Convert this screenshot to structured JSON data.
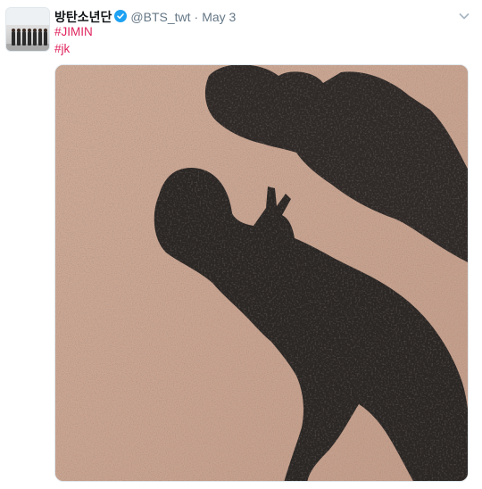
{
  "tweet": {
    "author_name": "방탄소년단",
    "handle": "@BTS_twt",
    "separator": "·",
    "date": "May 3",
    "hashtags": [
      "#JIMIN",
      "#jk"
    ],
    "verified": true,
    "icons": {
      "verified": "verified-badge-icon",
      "caret": "chevron-down-icon"
    },
    "colors": {
      "hashtag": "#e0245e",
      "handle": "#657786",
      "verified": "#1da1f2",
      "name": "#14171a"
    },
    "media": {
      "type": "photo",
      "subject": "two shadows on gravel, one making a peace sign"
    }
  }
}
